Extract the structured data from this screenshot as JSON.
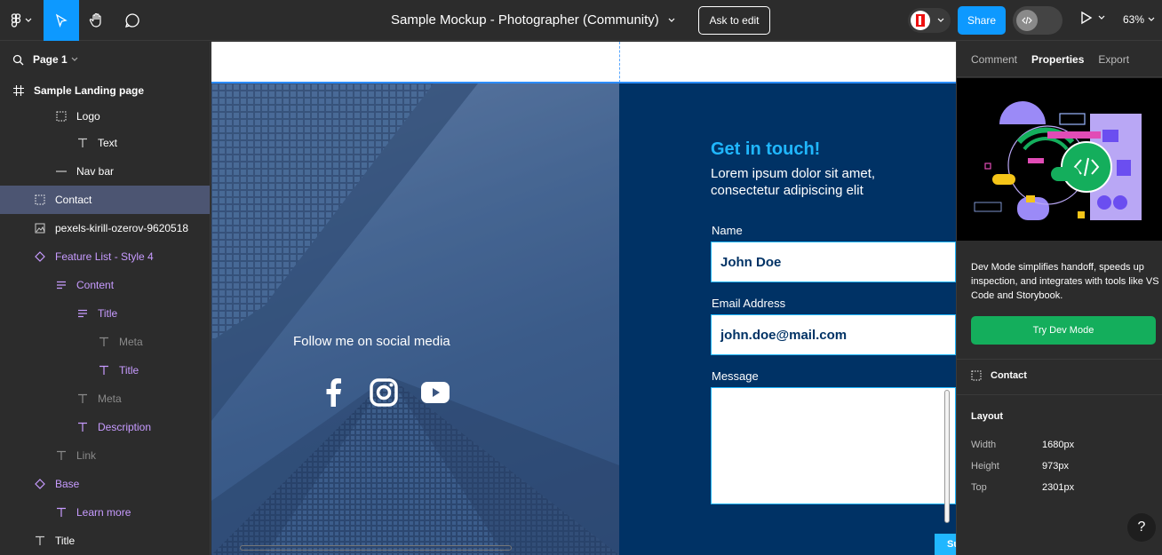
{
  "topbar": {
    "doc_title": "Sample Mockup - Photographer (Community)",
    "ask_to_edit": "Ask to edit",
    "share": "Share",
    "zoom": "63%"
  },
  "left": {
    "page": "Page 1",
    "frame": "Sample Landing page",
    "layers": [
      {
        "label": "Logo"
      },
      {
        "label": "Text"
      },
      {
        "label": "Nav bar"
      },
      {
        "label": "Contact"
      },
      {
        "label": "pexels-kirill-ozerov-9620518"
      },
      {
        "label": "Feature List - Style 4"
      },
      {
        "label": "Content"
      },
      {
        "label": "Title"
      },
      {
        "label": "Meta"
      },
      {
        "label": "Title"
      },
      {
        "label": "Meta"
      },
      {
        "label": "Description"
      },
      {
        "label": "Link"
      },
      {
        "label": "Base"
      },
      {
        "label": "Learn more"
      },
      {
        "label": "Title"
      }
    ]
  },
  "canvas": {
    "follow": "Follow me on social media",
    "heading": "Get in touch!",
    "lorem": "Lorem ipsum dolor sit amet, consectetur adipiscing elit",
    "name_label": "Name",
    "name_value": "John Doe",
    "email_label": "Email Address",
    "email_value": "john.doe@mail.com",
    "message_label": "Message",
    "submit": "Su"
  },
  "right": {
    "tabs": [
      "Comment",
      "Properties",
      "Export"
    ],
    "dev_text": "Dev Mode simplifies handoff, speeds up inspection, and integrates with tools like VS Code and Storybook.",
    "try_button": "Try Dev Mode",
    "selection": "Contact",
    "layout_heading": "Layout",
    "props": [
      {
        "label": "Width",
        "value": "1680px"
      },
      {
        "label": "Height",
        "value": "973px"
      },
      {
        "label": "Top",
        "value": "2301px"
      }
    ],
    "help": "?"
  },
  "colors": {
    "accent": "#0d99ff",
    "contact_bg": "#003265",
    "contact_accent": "#20b7ff",
    "dev_green": "#14ae5c",
    "layer_purple": "#c79bff"
  }
}
